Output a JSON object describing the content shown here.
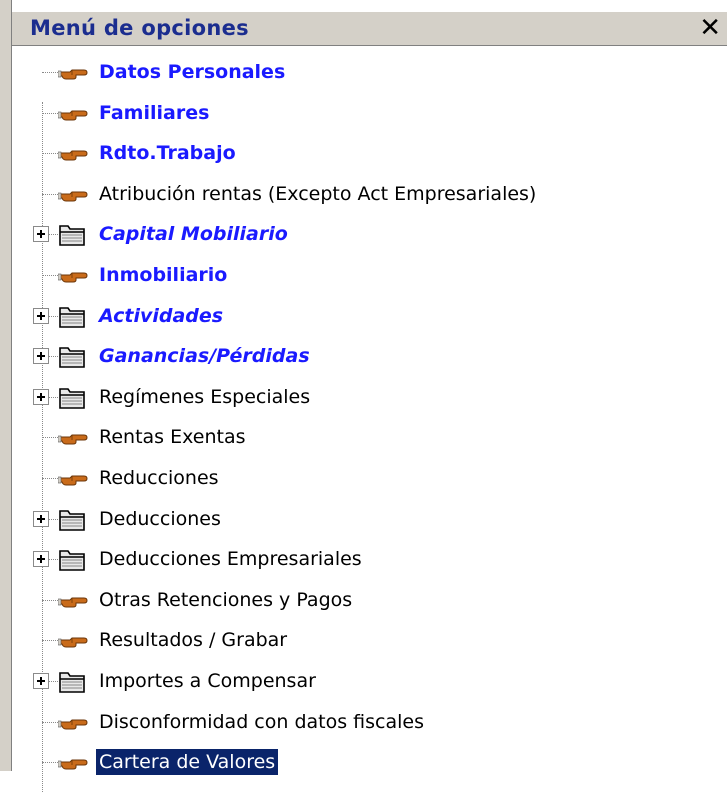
{
  "panel": {
    "title": "Menú de opciones",
    "close_symbol": "✕"
  },
  "items": [
    {
      "label": "Datos Personales",
      "icon": "hand-pointer-icon",
      "style": "bold",
      "expandable": false
    },
    {
      "label": "Familiares",
      "icon": "hand-pointer-icon",
      "style": "bold",
      "expandable": false
    },
    {
      "label": "Rdto.Trabajo",
      "icon": "hand-pointer-icon",
      "style": "bold",
      "expandable": false
    },
    {
      "label": "Atribución rentas (Excepto Act Empresariales)",
      "icon": "hand-pointer-icon",
      "style": "plain",
      "expandable": false
    },
    {
      "label": "Capital Mobiliario",
      "icon": "folder-icon",
      "style": "bold-italic",
      "expandable": true
    },
    {
      "label": "Inmobiliario",
      "icon": "hand-pointer-icon",
      "style": "bold",
      "expandable": false
    },
    {
      "label": "Actividades",
      "icon": "folder-icon",
      "style": "bold-italic",
      "expandable": true
    },
    {
      "label": "Ganancias/Pérdidas",
      "icon": "folder-icon",
      "style": "bold-italic",
      "expandable": true
    },
    {
      "label": "Regímenes Especiales",
      "icon": "folder-icon",
      "style": "plain",
      "expandable": true
    },
    {
      "label": "Rentas Exentas",
      "icon": "hand-pointer-icon",
      "style": "plain",
      "expandable": false
    },
    {
      "label": "Reducciones",
      "icon": "hand-pointer-icon",
      "style": "plain",
      "expandable": false
    },
    {
      "label": "Deducciones",
      "icon": "folder-icon",
      "style": "plain",
      "expandable": true
    },
    {
      "label": "Deducciones Empresariales",
      "icon": "folder-icon",
      "style": "plain",
      "expandable": true
    },
    {
      "label": "Otras Retenciones y Pagos",
      "icon": "hand-pointer-icon",
      "style": "plain",
      "expandable": false
    },
    {
      "label": "Resultados / Grabar",
      "icon": "hand-pointer-icon",
      "style": "plain",
      "expandable": false
    },
    {
      "label": "Importes a Compensar",
      "icon": "folder-icon",
      "style": "plain",
      "expandable": true
    },
    {
      "label": "Disconformidad con datos fiscales",
      "icon": "hand-pointer-icon",
      "style": "plain",
      "expandable": false
    },
    {
      "label": "Cartera de Valores",
      "icon": "hand-pointer-icon",
      "style": "selected",
      "expandable": false
    }
  ],
  "colors": {
    "title": "#1b2d8f",
    "bold_item": "#1a1aff",
    "selection": "#0a246a"
  }
}
